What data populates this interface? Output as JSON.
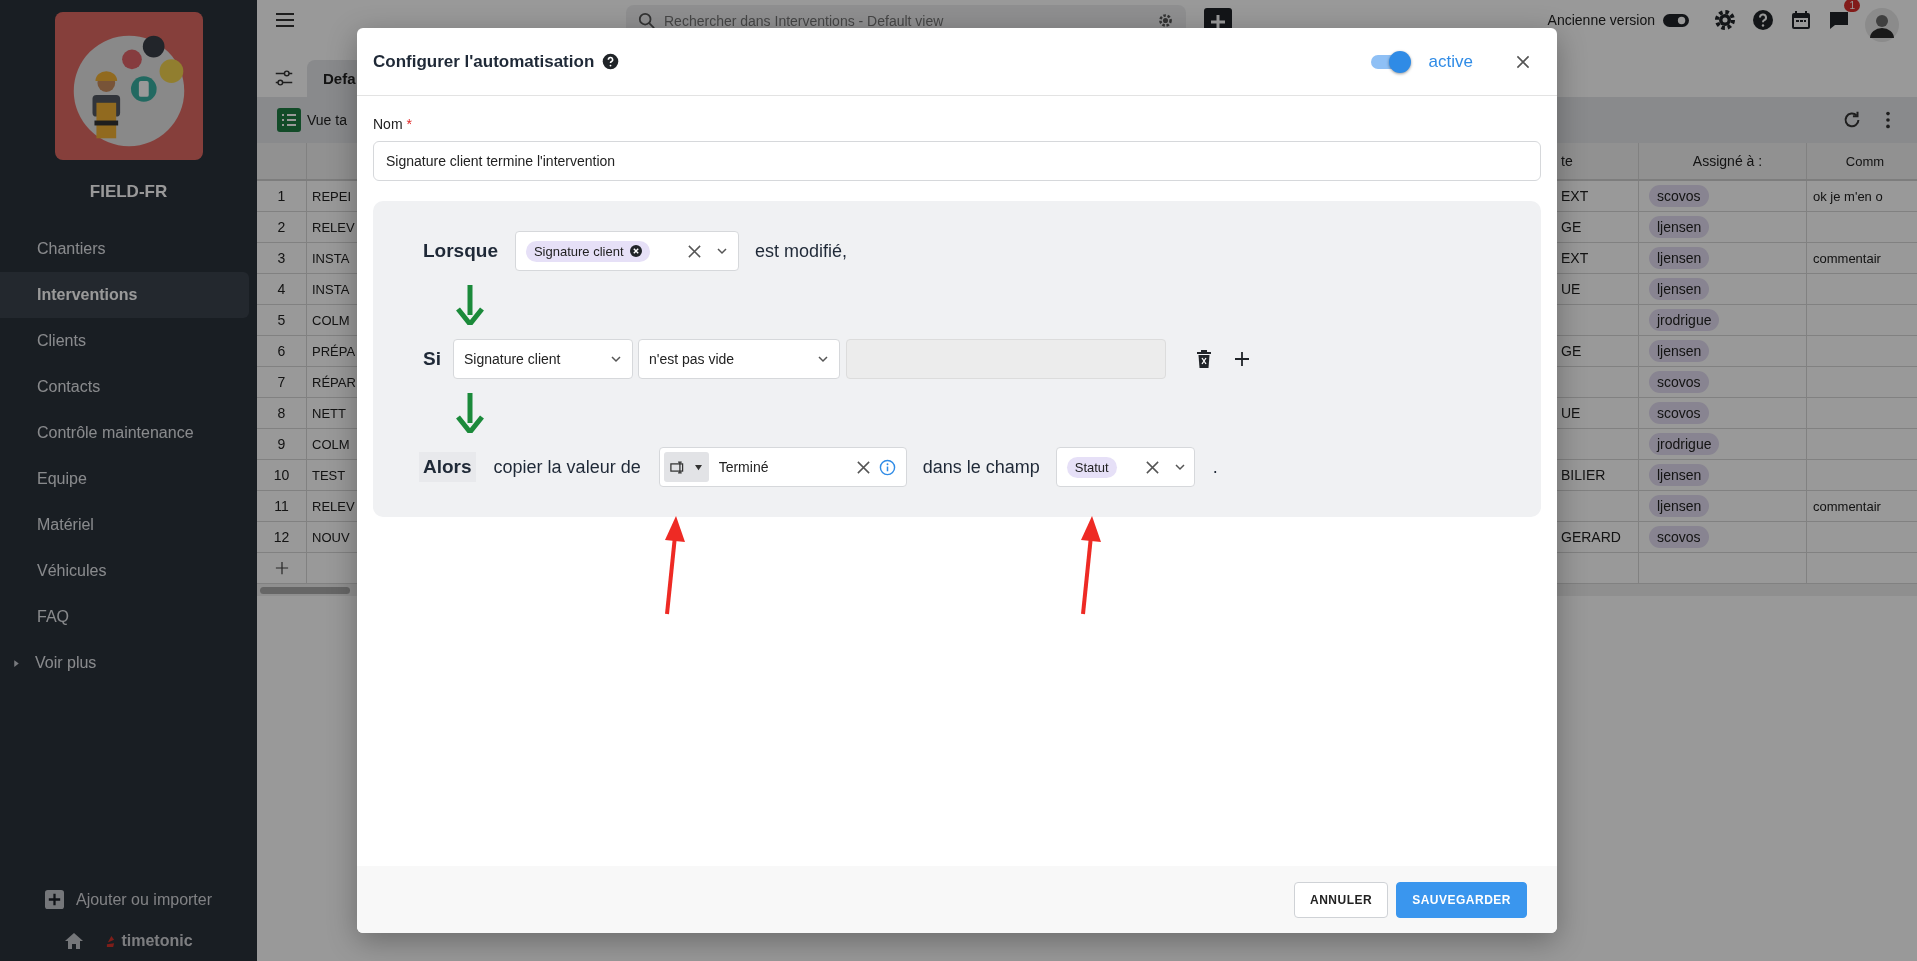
{
  "sidebar": {
    "app_name": "FIELD-FR",
    "items": [
      {
        "label": "Chantiers",
        "selected": false
      },
      {
        "label": "Interventions",
        "selected": true
      },
      {
        "label": "Clients",
        "selected": false
      },
      {
        "label": "Contacts",
        "selected": false
      },
      {
        "label": "Contrôle maintenance",
        "selected": false
      },
      {
        "label": "Equipe",
        "selected": false
      },
      {
        "label": "Matériel",
        "selected": false
      },
      {
        "label": "Véhicules",
        "selected": false
      },
      {
        "label": "FAQ",
        "selected": false
      }
    ],
    "more": {
      "label": "Voir plus",
      "expanded": false
    },
    "add_label": "Ajouter ou importer",
    "brand": "timetonic"
  },
  "topbar": {
    "search": {
      "placeholder": "Rechercher dans Interventions - Default view"
    },
    "old_version_label": "Ancienne version",
    "notification_count": "1"
  },
  "view_tab": "Defa",
  "view_button": "Vue ta",
  "table": {
    "right_headers": [
      "te",
      "Assigné à :",
      "Comm"
    ],
    "rows": [
      {
        "number": "1",
        "column_2": "REPEI",
        "column_3": "EXT",
        "assignee": "scovos",
        "comment": "ok je m'en o"
      },
      {
        "number": "2",
        "column_2": "RELEV",
        "column_3": "GE",
        "assignee": "ljensen"
      },
      {
        "number": "3",
        "column_2": "INSTA",
        "column_3": "EXT",
        "assignee": "ljensen",
        "comment": "commentair"
      },
      {
        "number": "4",
        "column_2": "INSTA",
        "column_3": "UE",
        "assignee": "ljensen"
      },
      {
        "number": "5",
        "column_2": "COLM",
        "assignee": "jrodrigue"
      },
      {
        "number": "6",
        "column_2": "PRÉPA",
        "column_3": "GE",
        "assignee": "ljensen"
      },
      {
        "number": "7",
        "column_2": "RÉPAR",
        "assignee": "scovos"
      },
      {
        "number": "8",
        "column_2": "NETT",
        "column_3": "UE",
        "assignee": "scovos"
      },
      {
        "number": "9",
        "column_2": "COLM",
        "assignee": "jrodrigue"
      },
      {
        "number": "10",
        "column_2": "TEST",
        "column_3": "BILIER",
        "assignee": "ljensen"
      },
      {
        "number": "11",
        "column_2": "RELEV",
        "assignee": "ljensen",
        "comment": "commentair"
      },
      {
        "number": "12",
        "column_2": "NOUV",
        "column_3": "GERARD",
        "assignee": "scovos"
      }
    ]
  },
  "dialog": {
    "title": "Configurer l'automatisation",
    "active": {
      "label": "active",
      "on": true
    },
    "name_label": "Nom",
    "required_mark": "*",
    "name_value": "Signature client termine l'intervention",
    "when": {
      "keyword": "Lorsque",
      "field_tag": "Signature client",
      "suffix": "est modifié,"
    },
    "condition": {
      "keyword": "Si",
      "field": "Signature client",
      "operator": "n'est pas vide"
    },
    "action": {
      "keyword": "Alors",
      "text": "copier la valeur de",
      "value": "Terminé",
      "middle": "dans le champ",
      "target_tag": "Statut",
      "end": "."
    },
    "buttons": [
      {
        "label": "ANNULER",
        "kind": "secondary"
      },
      {
        "label": "SAUVEGARDER",
        "kind": "primary"
      }
    ]
  }
}
